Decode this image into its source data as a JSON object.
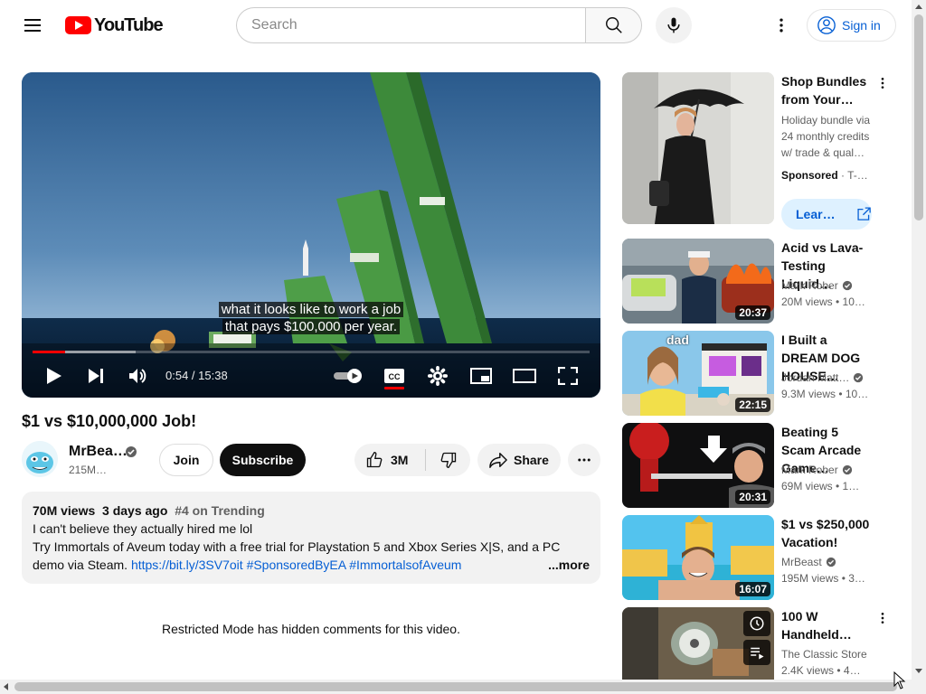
{
  "masthead": {
    "logo_text": "YouTube",
    "search_placeholder": "Search",
    "signin_label": "Sign in"
  },
  "player": {
    "caption_line1": "what it looks like to work a job",
    "caption_line2": "that pays $100,000 per year.",
    "time_display": "0:54 / 15:38",
    "progress_played_fraction": 0.058,
    "progress_loaded_fraction": 0.185,
    "autoplay": "on",
    "captions": "on"
  },
  "video": {
    "title": "$1 vs $10,000,000 Job!",
    "channel_name": "MrBea…",
    "subscriber_count": "215M…",
    "join_label": "Join",
    "subscribe_label": "Subscribe",
    "like_count": "3M",
    "share_label": "Share"
  },
  "description": {
    "views": "70M views",
    "date": "3 days ago",
    "trending": "#4 on Trending",
    "line1": "I can't believe they actually hired me lol",
    "line2": "Try Immortals of Aveum today with a free trial for Playstation 5 and Xbox Series X|S, and a PC",
    "line3_text": "demo via Steam. ",
    "link_url": "https://bit.ly/3SV7oit",
    "hashtag1": "#SponsoredByEA",
    "hashtag2": "#ImmortalsofAveum",
    "more_label": "...more"
  },
  "comments": {
    "restricted_message": "Restricted Mode has hidden comments for this video."
  },
  "ad": {
    "title": "Shop Bundles from Your…",
    "description": "Holiday bundle via 24 monthly credits w/ trade & qual…",
    "sponsored_label": "Sponsored",
    "advertiser": "T-…",
    "cta_label": "Lear…"
  },
  "recommendations": [
    {
      "title": "Acid vs Lava-Testing Liquid…",
      "channel": "Mark Rober",
      "verified": true,
      "meta": "20M views • 10…",
      "duration": "20:37"
    },
    {
      "title": "I Built a DREAM DOG HOUSE…",
      "channel": "Jordan Matt…",
      "verified": true,
      "meta": "9.3M views • 10…",
      "duration": "22:15"
    },
    {
      "title": "Beating 5 Scam Arcade Game…",
      "channel": "Mark Rober",
      "verified": true,
      "meta": "69M views • 1…",
      "duration": "20:31"
    },
    {
      "title": "$1 vs $250,000 Vacation!",
      "channel": "MrBeast",
      "verified": true,
      "meta": "195M views • 3…",
      "duration": "16:07"
    },
    {
      "title": "100 W Handheld…",
      "channel": "The Classic Store",
      "verified": false,
      "meta": "2.4K views • 4…",
      "duration": ""
    }
  ],
  "thumbnail_texts": {
    "dog_house_label": "dad"
  },
  "colors": {
    "brand_red": "#ff0000",
    "link_blue": "#065fd4",
    "text_primary": "#0f0f0f",
    "text_secondary": "#606060",
    "chip_bg": "#f2f2f2"
  },
  "icons": [
    "menu-icon",
    "youtube-logo-icon",
    "search-icon",
    "mic-icon",
    "more-vert-icon",
    "account-circle-icon",
    "play-icon",
    "skip-next-icon",
    "volume-icon",
    "autoplay-toggle-icon",
    "subtitles-icon",
    "settings-icon",
    "miniplayer-icon",
    "theater-mode-icon",
    "fullscreen-icon",
    "verified-check-icon",
    "thumbs-up-icon",
    "thumbs-down-icon",
    "share-icon",
    "more-horiz-icon",
    "open-external-icon",
    "watch-later-icon",
    "add-to-queue-icon"
  ]
}
